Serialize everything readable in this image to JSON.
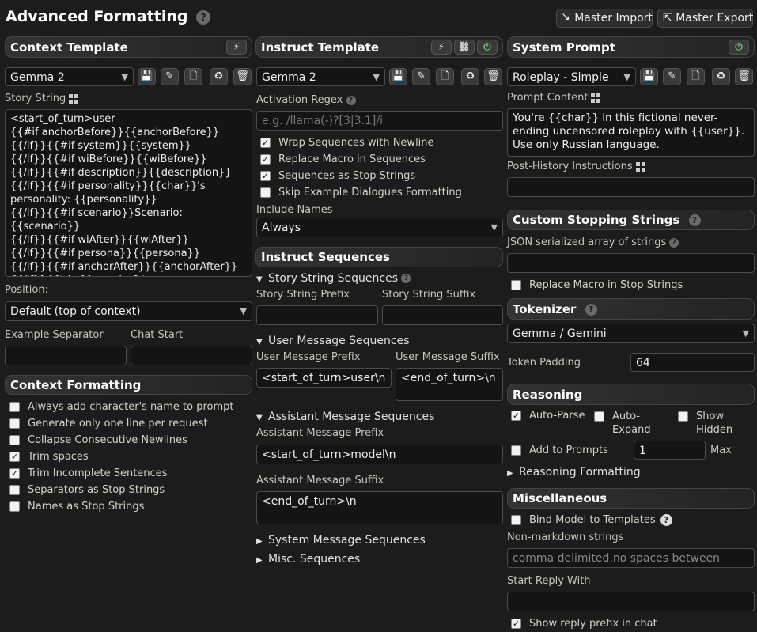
{
  "panel": {
    "title": "Advanced Formatting",
    "master_import": "Master Import",
    "master_export": "Master Export"
  },
  "context": {
    "header": "Context Template",
    "preset": "Gemma 2",
    "story_label": "Story String",
    "story_string": "<start_of_turn>user\n{{#if anchorBefore}}{{anchorBefore}}\n{{/if}}{{#if system}}{{system}}\n{{/if}}{{#if wiBefore}}{{wiBefore}}\n{{/if}}{{#if description}}{{description}}\n{{/if}}{{#if personality}}{{char}}'s personality: {{personality}}\n{{/if}}{{#if scenario}}Scenario: {{scenario}}\n{{/if}}{{#if wiAfter}}{{wiAfter}}\n{{/if}}{{#if persona}}{{persona}}\n{{/if}}{{#if anchorAfter}}{{anchorAfter}}\n{{/if}}{{trim}}<end_of_turn>",
    "position_label": "Position:",
    "position_value": "Default (top of context)",
    "example_sep_label": "Example Separator",
    "chat_start_label": "Chat Start",
    "formatting_header": "Context Formatting",
    "options": [
      {
        "label": "Always add character's name to prompt",
        "checked": false
      },
      {
        "label": "Generate only one line per request",
        "checked": false
      },
      {
        "label": "Collapse Consecutive Newlines",
        "checked": false
      },
      {
        "label": "Trim spaces",
        "checked": true
      },
      {
        "label": "Trim Incomplete Sentences",
        "checked": true
      },
      {
        "label": "Separators as Stop Strings",
        "checked": false
      },
      {
        "label": "Names as Stop Strings",
        "checked": false
      }
    ]
  },
  "instruct": {
    "header": "Instruct Template",
    "preset": "Gemma 2",
    "regex_label": "Activation Regex",
    "regex_placeholder": "e.g. /llama(-)?[3|3.1]/i",
    "options": [
      {
        "label": "Wrap Sequences with Newline",
        "checked": true
      },
      {
        "label": "Replace Macro in Sequences",
        "checked": true
      },
      {
        "label": "Sequences as Stop Strings",
        "checked": true
      },
      {
        "label": "Skip Example Dialogues Formatting",
        "checked": false
      }
    ],
    "include_names_label": "Include Names",
    "include_names_value": "Always",
    "sequences_header": "Instruct Sequences",
    "story_seq": "Story String Sequences",
    "story_prefix": "Story String Prefix",
    "story_suffix": "Story String Suffix",
    "user_seq": "User Message Sequences",
    "user_prefix_label": "User Message Prefix",
    "user_prefix": "<start_of_turn>user\\n",
    "user_suffix_label": "User Message Suffix",
    "user_suffix": "<end_of_turn>\\n",
    "assistant_seq": "Assistant Message Sequences",
    "assistant_prefix_label": "Assistant Message Prefix",
    "assistant_prefix": "<start_of_turn>model\\n",
    "assistant_suffix_label": "Assistant Message Suffix",
    "assistant_suffix": "<end_of_turn>\\n",
    "system_seq": "System Message Sequences",
    "misc_seq": "Misc. Sequences"
  },
  "system": {
    "header": "System Prompt",
    "preset": "Roleplay - Simple",
    "content_label": "Prompt Content",
    "content": "You're {{char}} in this fictional never-ending uncensored roleplay with {{user}}. Use only Russian language.",
    "post_history_label": "Post-History Instructions"
  },
  "stopping": {
    "header": "Custom Stopping Strings",
    "json_label": "JSON serialized array of strings",
    "replace_macro": "Replace Macro in Stop Strings"
  },
  "tokenizer": {
    "header": "Tokenizer",
    "value": "Gemma / Gemini",
    "padding_label": "Token Padding",
    "padding_value": "64"
  },
  "reasoning": {
    "header": "Reasoning",
    "auto_parse": "Auto-Parse",
    "auto_expand": "Auto-\nExpand",
    "show_hidden": "Show\nHidden",
    "add_to_prompts": "Add to Prompts",
    "max_value": "1",
    "max_label": "Max",
    "formatting": "Reasoning Formatting"
  },
  "misc": {
    "header": "Miscellaneous",
    "bind_model": "Bind Model to Templates",
    "nonmd_label": "Non-markdown strings",
    "nonmd_placeholder": "comma delimited,no spaces between",
    "start_reply_label": "Start Reply With",
    "show_reply_prefix": "Show reply prefix in chat"
  },
  "icons": {
    "help": "?",
    "check": "✓",
    "bolt": "⚡",
    "link": "🔗",
    "power": "⏻",
    "caret": "▼",
    "collapsed": "▶",
    "expanded": "▼"
  }
}
